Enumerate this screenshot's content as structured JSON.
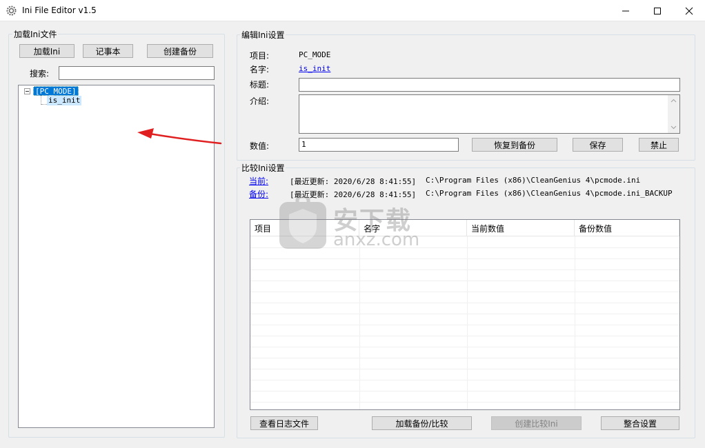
{
  "window": {
    "title": "Ini File Editor v1.5"
  },
  "load_group": {
    "label": "加载Ini文件",
    "load_button": "加载Ini",
    "notepad_button": "记事本",
    "create_backup_button": "创建备份",
    "search_label": "搜索:",
    "search_value": ""
  },
  "tree": {
    "root": "[PC_MODE]",
    "child": "is_init"
  },
  "edit_group": {
    "label": "编辑Ini设置",
    "item_label": "项目:",
    "item_value": "PC_MODE",
    "name_label": "名字:",
    "name_value": "is_init",
    "title_label": "标题:",
    "title_value": "",
    "intro_label": "介绍:",
    "intro_value": "",
    "value_label": "数值:",
    "value_value": "1",
    "restore_button": "恢复到备份",
    "save_button": "保存",
    "disable_button": "禁止"
  },
  "compare_group": {
    "label": "比较Ini设置",
    "current_label": "当前:",
    "current_updated": "[最近更新: 2020/6/28 8:41:55]",
    "current_path": "C:\\Program Files (x86)\\CleanGenius 4\\pcmode.ini",
    "backup_label": "备份:",
    "backup_updated": "[最近更新: 2020/6/28 8:41:55]",
    "backup_path": "C:\\Program Files (x86)\\CleanGenius 4\\pcmode.ini_BACKUP",
    "columns": [
      "项目",
      "名字",
      "当前数值",
      "备份数值"
    ],
    "view_log_button": "查看日志文件",
    "load_compare_button": "加载备份/比较",
    "create_compare_button": "创建比较Ini",
    "merge_button": "整合设置"
  },
  "watermark": {
    "cn": "安下载",
    "en": "anxz.com"
  },
  "colors": {
    "selection": "#0078d7",
    "selection_light": "#cce8ff",
    "link": "#0000ee",
    "annotation_arrow": "#e02020"
  }
}
